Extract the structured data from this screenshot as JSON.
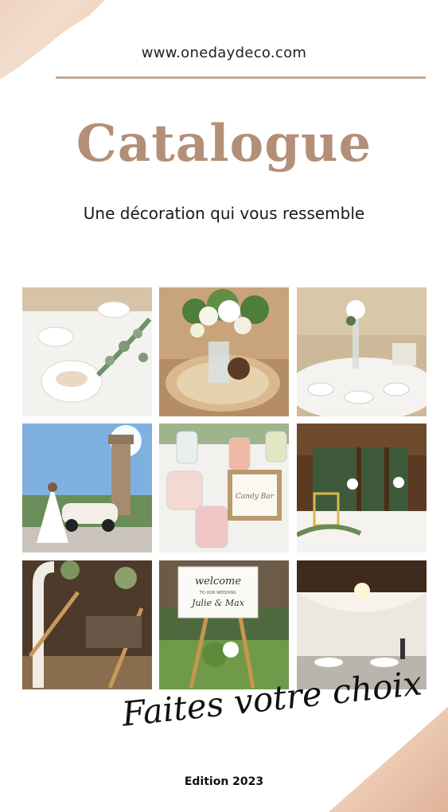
{
  "header": {
    "url": "www.onedaydeco.com"
  },
  "title": "Catalogue",
  "subtitle": "Une décoration qui vous ressemble",
  "photos": {
    "p5": {
      "jar_label": "Candy Bar"
    },
    "p8": {
      "sign_line1": "welcome",
      "sign_line2": "TO OUR WEDDING",
      "sign_names": "Julie & Max"
    }
  },
  "tagline": "Faites votre choix",
  "footer": {
    "edition": "Edition 2023"
  },
  "colors": {
    "accent": "#b38f77",
    "rule": "#c2a896",
    "text": "#1a1a1a"
  }
}
